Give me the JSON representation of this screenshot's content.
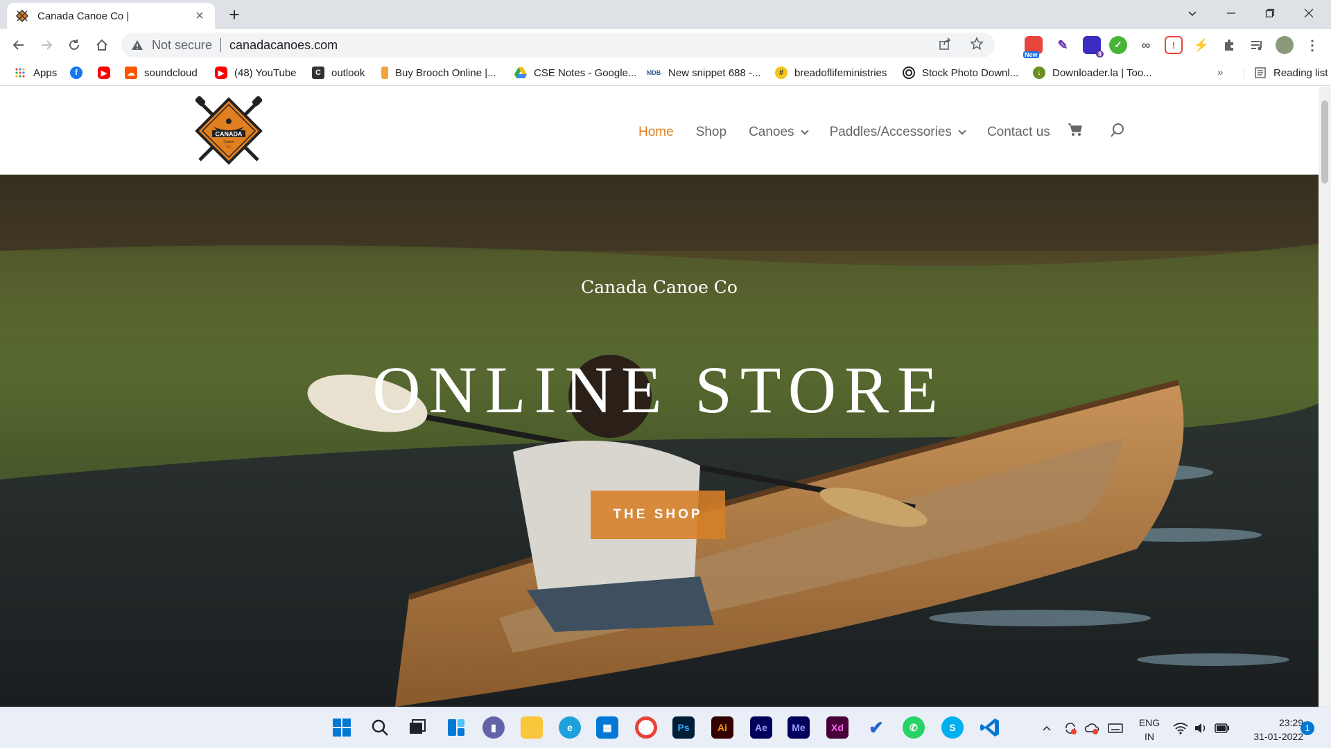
{
  "browser": {
    "tab_title": "Canada Canoe Co |",
    "new_tab": "+",
    "security_label": "Not secure",
    "url": "canadacanoes.com",
    "ext_new_badge": "New",
    "ext_count_badge": "8",
    "bookmarks_overflow": "»",
    "reading_list": "Reading list"
  },
  "bookmarks": [
    {
      "label": "Apps",
      "icon": "apps-grid-icon",
      "color": "#4285f4"
    },
    {
      "label": "",
      "icon": "facebook-icon",
      "color": "#1877f2"
    },
    {
      "label": "",
      "icon": "youtube-icon",
      "color": "#ff0000"
    },
    {
      "label": "soundcloud",
      "icon": "soundcloud-icon",
      "color": "#ff5500"
    },
    {
      "label": "(48) YouTube",
      "icon": "youtube-icon",
      "color": "#ff0000"
    },
    {
      "label": "outlook",
      "icon": "outlook-icon",
      "color": "#333333"
    },
    {
      "label": "Buy Brooch Online |...",
      "icon": "brooch-icon",
      "color": "#f2a33a"
    },
    {
      "label": "CSE Notes - Google...",
      "icon": "google-drive-icon",
      "color": "#34a853"
    },
    {
      "label": "New snippet 688 -...",
      "icon": "mdb-icon",
      "color": "#3b5998"
    },
    {
      "label": "breadoflifeministries",
      "icon": "bread-icon",
      "color": "#f5c518"
    },
    {
      "label": "Stock Photo Downl...",
      "icon": "stock-photo-icon",
      "color": "#222222"
    },
    {
      "label": "Downloader.la | Too...",
      "icon": "downloader-icon",
      "color": "#6b8e23"
    }
  ],
  "site": {
    "nav": {
      "home": "Home",
      "shop": "Shop",
      "canoes": "Canoes",
      "paddles": "Paddles/Accessories",
      "contact": "Contact us"
    },
    "logo_text": "CANADA",
    "logo_sub": "Canoe",
    "logo_sub2": "Co.",
    "hero_tagline": "Canada Canoe Co",
    "hero_title": "ONLINE STORE",
    "hero_button": "THE SHOP",
    "accent_color": "#e07f20"
  },
  "taskbar": {
    "apps": [
      "start",
      "search",
      "task-view",
      "widgets",
      "chat",
      "file-explorer",
      "edge",
      "store",
      "chrome",
      "Ps",
      "Ai",
      "Ae",
      "Me",
      "Xd",
      "todo",
      "whatsapp",
      "skype",
      "vscode"
    ],
    "lang_line1": "ENG",
    "lang_line2": "IN",
    "time": "23:29",
    "date": "31-01-2022",
    "notification_count": "1"
  }
}
